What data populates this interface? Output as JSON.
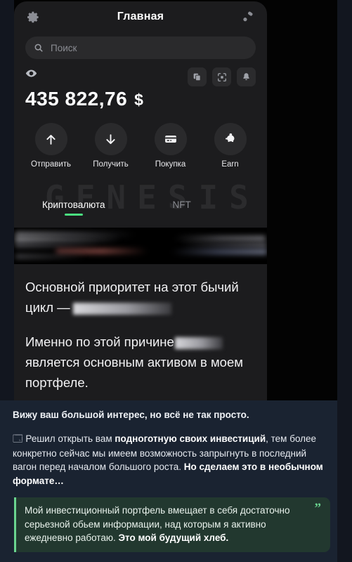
{
  "theme": {
    "page_background": "#12161f",
    "message_background": "#1a2331",
    "app_card_background": "#1c1c1e",
    "accent_green": "#4ade80",
    "quote_border": "#6ad48f",
    "quote_background": "#22382f"
  },
  "app": {
    "header": {
      "title": "Главная",
      "settings_icon": "gear-icon",
      "connect_icon": "link-nodes-icon"
    },
    "search": {
      "placeholder": "Поиск",
      "icon": "search-icon"
    },
    "balance": {
      "visibility_icon": "eye-icon",
      "amount": "435 822,76",
      "currency": "$",
      "actions": [
        {
          "name": "copy-icon",
          "label": "copy"
        },
        {
          "name": "scan-qr-icon",
          "label": "scan"
        },
        {
          "name": "bell-icon",
          "label": "notifications"
        }
      ]
    },
    "quick_actions": [
      {
        "label": "Отправить",
        "icon": "arrow-up-icon"
      },
      {
        "label": "Получить",
        "icon": "arrow-down-icon"
      },
      {
        "label": "Покупка",
        "icon": "credit-card-icon"
      },
      {
        "label": "Earn",
        "icon": "piggy-bank-icon"
      }
    ],
    "watermark": "GENESIS",
    "tabs": [
      {
        "label": "Криптовалюта",
        "active": true
      },
      {
        "label": "NFT",
        "active": false
      }
    ],
    "asset_row": {
      "state": "blurred",
      "note": "censored asset list row"
    },
    "post": {
      "line1_before": "Основной приоритет на этот бычий цикл —",
      "line1_censored": "censored-asset-name",
      "line2_before": "Именно по этой причине",
      "line2_censored": "censored-asset-name",
      "line2_after": "является основным активом в моем портфеле."
    }
  },
  "message": {
    "lead": "Вижу ваш большой интерес, но всё не так просто.",
    "paragraph": {
      "icon": "fingerprint-icon",
      "part1": "Решил открыть вам ",
      "bold1": "подноготную своих инвестиций",
      "part2": ", тем более конкретно сейчас мы имеем возможность запрыгнуть в последний вагон перед началом большого роста. ",
      "bold2": "Но сделаем это в необычном формате…"
    },
    "quote": {
      "mark": "”",
      "part1": "Мой инвестиционный портфель вмещает в себя достаточно серьезной обьем информации, над которым я активно ежедневно работаю. ",
      "bold1": "Это мой будущий хлеб."
    }
  }
}
